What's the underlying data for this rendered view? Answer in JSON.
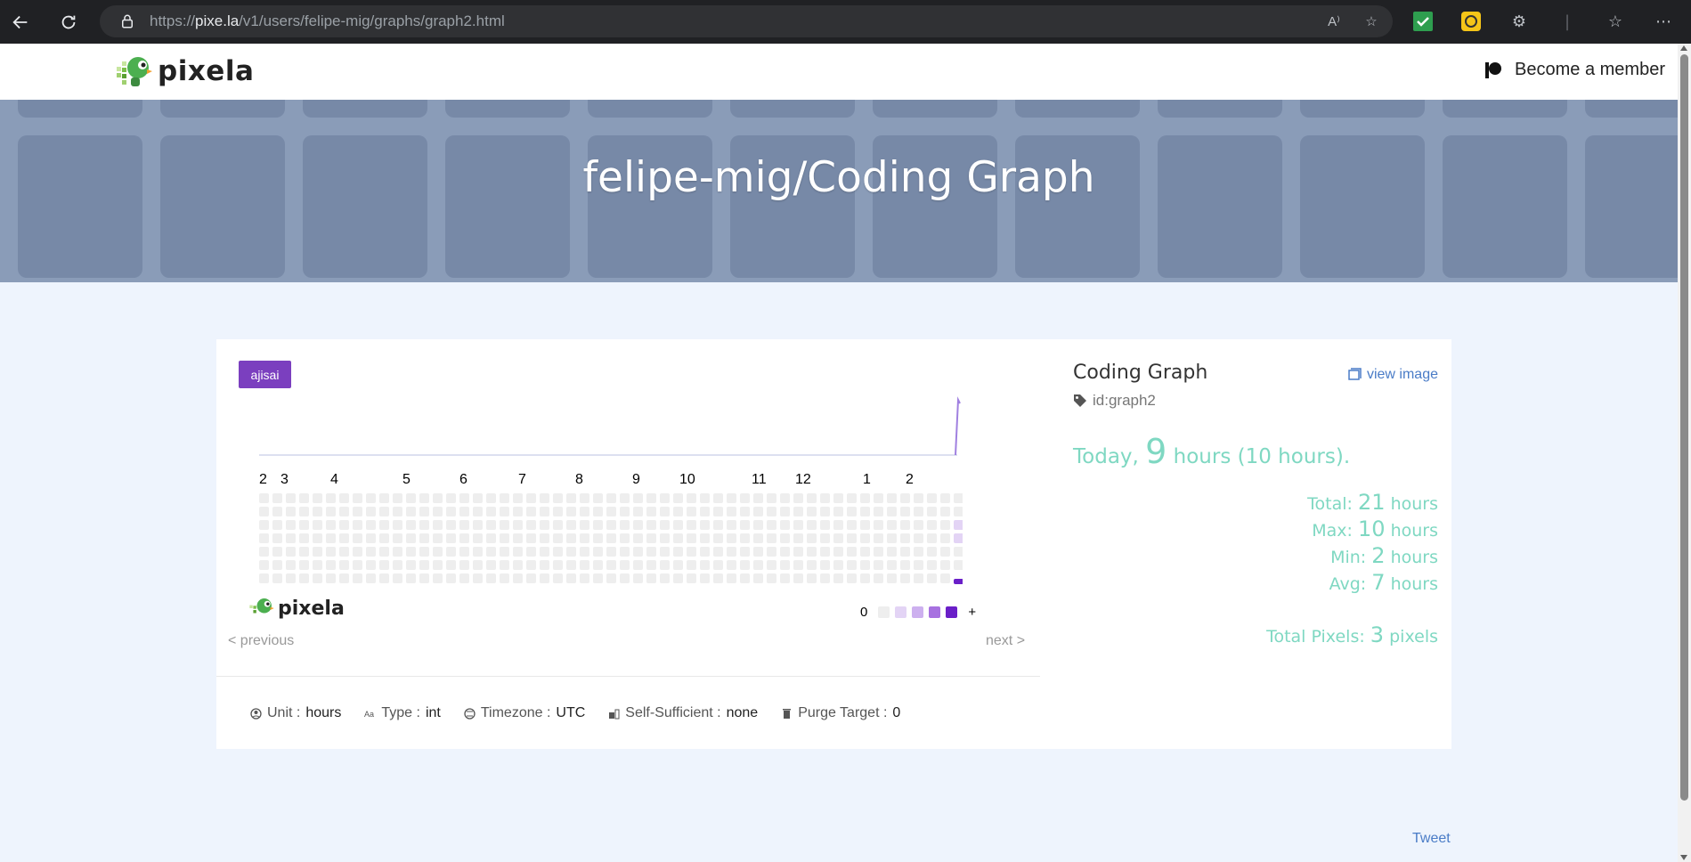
{
  "browser": {
    "url_prefix": "https://",
    "url_domain": "pixe.la",
    "url_path": "/v1/users/felipe-mig/graphs/graph2.html",
    "read_aloud_label": "A⁾"
  },
  "header": {
    "logo_text": "pixela",
    "member_label": "Become a member"
  },
  "hero": {
    "title": "felipe-mig/Coding Graph"
  },
  "graph": {
    "theme_badge": "ajisai",
    "month_labels": [
      "2",
      "3",
      "4",
      "5",
      "6",
      "7",
      "8",
      "9",
      "10",
      "11",
      "12",
      "1",
      "2"
    ],
    "legend_zero": "0",
    "legend_plus": "+",
    "legend_colors": [
      "#eeeeee",
      "#e3d4f5",
      "#cdb0ef",
      "#a771e0",
      "#6a1fc8"
    ],
    "card_logo_text": "pixela",
    "prev_label": "< previous",
    "next_label": "next >",
    "colors": {
      "empty": "#eeeeee",
      "light": "#e3d4f5",
      "dark": "#6a1fc8",
      "line": "#a080e0"
    }
  },
  "chart_data": {
    "type": "heatmap",
    "columns": 53,
    "rows": 7,
    "filled_cells": [
      {
        "column": 52,
        "row": 2,
        "level": "light"
      },
      {
        "column": 52,
        "row": 3,
        "level": "light"
      },
      {
        "column": 52,
        "row": 6,
        "level": "dark"
      }
    ],
    "sparkline_peak_column": 52
  },
  "properties": [
    {
      "label": "Unit",
      "value": "hours",
      "icon": "user-circle-icon"
    },
    {
      "label": "Type",
      "value": "int",
      "icon": "type-icon"
    },
    {
      "label": "Timezone",
      "value": "UTC",
      "icon": "globe-icon"
    },
    {
      "label": "Self-Sufficient",
      "value": "none",
      "icon": "self-sufficient-icon"
    },
    {
      "label": "Purge Target",
      "value": "0",
      "icon": "trash-icon"
    }
  ],
  "side": {
    "graph_name": "Coding Graph",
    "view_image_label": "view image",
    "graph_id": "id:graph2",
    "today_label": "Today",
    "today_value": "9",
    "today_unit": "hours (10 hours).",
    "stats": [
      {
        "label": "Total:",
        "value": "21",
        "unit": "hours"
      },
      {
        "label": "Max:",
        "value": "10",
        "unit": "hours"
      },
      {
        "label": "Min:",
        "value": "2",
        "unit": "hours"
      },
      {
        "label": "Avg:",
        "value": "7",
        "unit": "hours"
      }
    ],
    "total_pixels_label": "Total Pixels:",
    "total_pixels_value": "3",
    "total_pixels_unit": "pixels"
  },
  "footer": {
    "tweet_label": "Tweet"
  }
}
